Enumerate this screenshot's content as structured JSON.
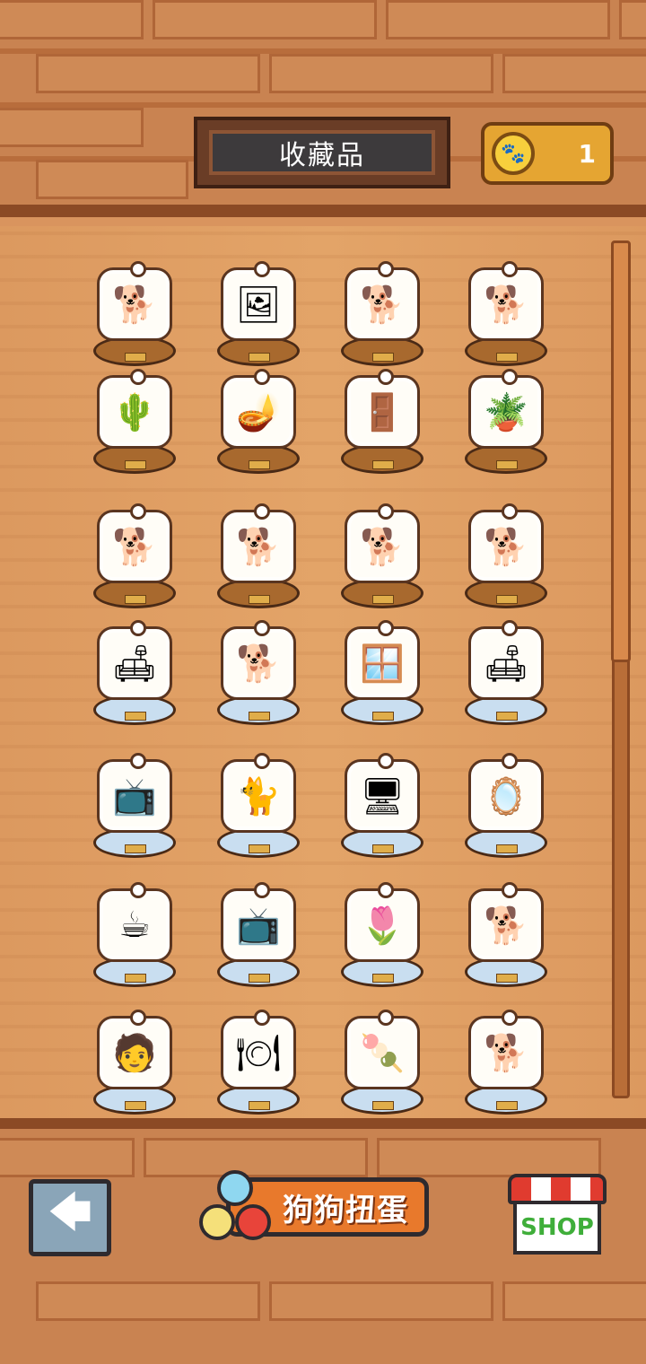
{
  "header": {
    "title": "收藏品",
    "coin_icon": "paw-coin-icon",
    "coin_count": "1"
  },
  "collection": {
    "items": [
      {
        "icon": "🐕",
        "stand": "wood",
        "name": "shiba-sitting"
      },
      {
        "icon": "🖼",
        "stand": "wood",
        "name": "framed-painting"
      },
      {
        "icon": "🐕",
        "stand": "wood",
        "name": "shiba-lying"
      },
      {
        "icon": "🐕",
        "stand": "wood",
        "name": "shiba-with-bowl"
      },
      {
        "icon": "🌵",
        "stand": "wood",
        "name": "shiba-with-cactus"
      },
      {
        "icon": "🪔",
        "stand": "wood",
        "name": "floor-lamp"
      },
      {
        "icon": "🚪",
        "stand": "wood",
        "name": "wardrobe"
      },
      {
        "icon": "🪴",
        "stand": "wood",
        "name": "plant-table"
      },
      {
        "icon": "🐕",
        "stand": "wood",
        "name": "shiba-sleeping"
      },
      {
        "icon": "🐕",
        "stand": "wood",
        "name": "shiba-with-hat"
      },
      {
        "icon": "🐕",
        "stand": "wood",
        "name": "shiba-stretching"
      },
      {
        "icon": "🐕",
        "stand": "wood",
        "name": "shiba-with-box"
      },
      {
        "icon": "🛋",
        "stand": "glass",
        "name": "shiba-armchair"
      },
      {
        "icon": "🐕",
        "stand": "glass",
        "name": "shiba-red-sofa"
      },
      {
        "icon": "🪟",
        "stand": "glass",
        "name": "round-window"
      },
      {
        "icon": "🛋",
        "stand": "glass",
        "name": "shiba-couch"
      },
      {
        "icon": "📺",
        "stand": "glass",
        "name": "tv-cabinet"
      },
      {
        "icon": "🐈",
        "stand": "glass",
        "name": "green-cat"
      },
      {
        "icon": "🖥",
        "stand": "glass",
        "name": "computer"
      },
      {
        "icon": "🪞",
        "stand": "glass",
        "name": "mirror"
      },
      {
        "icon": "☕",
        "stand": "glass",
        "name": "coffee-machine-shiba"
      },
      {
        "icon": "📺",
        "stand": "glass",
        "name": "tv-set"
      },
      {
        "icon": "🌷",
        "stand": "glass",
        "name": "shiba-flowerbed"
      },
      {
        "icon": "🐕",
        "stand": "glass",
        "name": "shiba-cushion"
      },
      {
        "icon": "🧑",
        "stand": "glass",
        "name": "boy-with-shiba"
      },
      {
        "icon": "🍽",
        "stand": "glass",
        "name": "dining-table"
      },
      {
        "icon": "🍡",
        "stand": "glass",
        "name": "shiba-skewer"
      },
      {
        "icon": "🐕",
        "stand": "glass",
        "name": "shiba-marbles"
      }
    ]
  },
  "footer": {
    "back_icon": "arrow-left-icon",
    "gacha_label": "狗狗扭蛋",
    "shop_label": "SHOP"
  }
}
